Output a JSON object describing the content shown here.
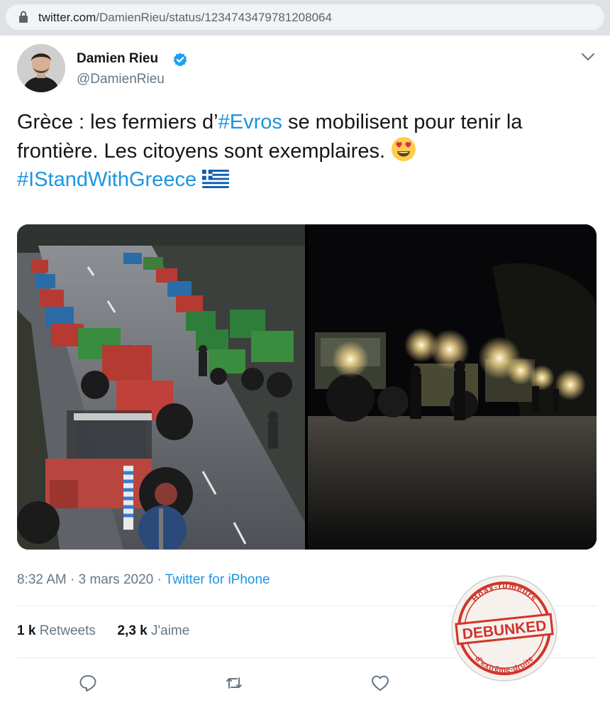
{
  "browser": {
    "url_host": "twitter.com",
    "url_path": "/DamienRieu/status/1234743479781208064"
  },
  "tweet": {
    "author": {
      "display_name": "Damien Rieu",
      "handle": "@DamienRieu",
      "verified": true
    },
    "text": {
      "part1": "Grèce : les fermiers d’",
      "hashtag1": "#Evros",
      "part2": " se mobilisent pour tenir la frontière. Les citoyens sont exemplaires. ",
      "emoji": "heart-eyes-emoji",
      "hashtag2": "#IStandWithGreece",
      "flag": "greek-flag"
    },
    "time": "8:32 AM",
    "separator": " · ",
    "date": "3 mars 2020",
    "source": "Twitter for iPhone",
    "retweets_count": "1 k",
    "retweets_label": " Retweets",
    "likes_count": "2,3 k",
    "likes_label": " J'aime"
  },
  "stamp": {
    "top_text": "Hoax-rumeurs",
    "center_text": "DEBUNKED",
    "bottom_text": "d'extrême-droite",
    "color": "#d0342c"
  },
  "colors": {
    "link": "#1b95e0",
    "secondary_text": "#657786",
    "verified": "#1da1f2"
  }
}
